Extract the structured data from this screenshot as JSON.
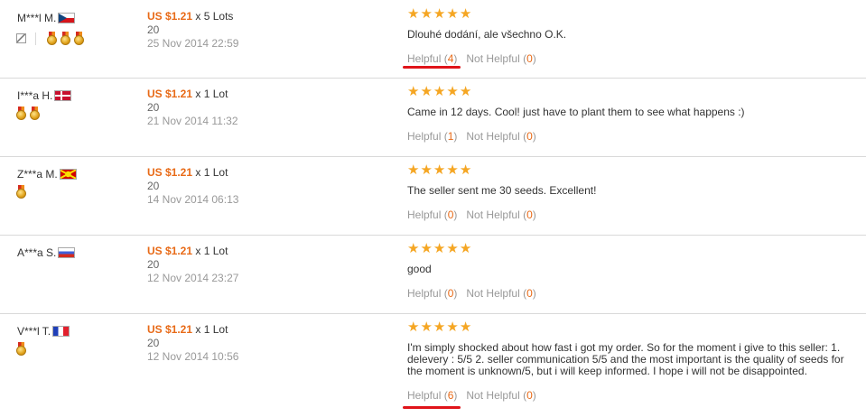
{
  "reviews": [
    {
      "buyer": "M***l M.",
      "flag": "cz",
      "medals": 3,
      "has_edit_icon": true,
      "price": "US $1.21",
      "quantity": "x 5 Lots",
      "pieces": "20",
      "date": "25 Nov 2014 22:59",
      "stars": 5,
      "text": "Dlouhé dodání, ale všechno O.K.",
      "helpful_label": "Helpful",
      "helpful_count": "4",
      "not_helpful_label": "Not Helpful",
      "not_helpful_count": "0",
      "underlined": true
    },
    {
      "buyer": "I***a H.",
      "flag": "dk",
      "medals": 2,
      "has_edit_icon": false,
      "price": "US $1.21",
      "quantity": "x 1 Lot",
      "pieces": "20",
      "date": "21 Nov 2014 11:32",
      "stars": 5,
      "text": "Came in 12 days. Cool! just have to plant them to see what happens :)",
      "helpful_label": "Helpful",
      "helpful_count": "1",
      "not_helpful_label": "Not Helpful",
      "not_helpful_count": "0",
      "underlined": false
    },
    {
      "buyer": "Z***a M.",
      "flag": "mk",
      "medals": 1,
      "has_edit_icon": false,
      "price": "US $1.21",
      "quantity": "x 1 Lot",
      "pieces": "20",
      "date": "14 Nov 2014 06:13",
      "stars": 5,
      "text": "The seller sent me 30 seeds. Excellent!",
      "helpful_label": "Helpful",
      "helpful_count": "0",
      "not_helpful_label": "Not Helpful",
      "not_helpful_count": "0",
      "underlined": false
    },
    {
      "buyer": "A***a S.",
      "flag": "ru",
      "medals": 0,
      "has_edit_icon": false,
      "price": "US $1.21",
      "quantity": "x 1 Lot",
      "pieces": "20",
      "date": "12 Nov 2014 23:27",
      "stars": 5,
      "text": "good",
      "helpful_label": "Helpful",
      "helpful_count": "0",
      "not_helpful_label": "Not Helpful",
      "not_helpful_count": "0",
      "underlined": false
    },
    {
      "buyer": "V***l T.",
      "flag": "fr",
      "medals": 1,
      "has_edit_icon": false,
      "price": "US $1.21",
      "quantity": "x 1 Lot",
      "pieces": "20",
      "date": "12 Nov 2014 10:56",
      "stars": 5,
      "text": "I'm simply shocked about how fast i got my order. So for the moment i give to this seller: 1. delevery : 5/5 2. seller communication 5/5 and the most important is the quality of seeds for the moment is unknown/5, but i will keep informed. I hope i will not be disappointed.",
      "helpful_label": "Helpful",
      "helpful_count": "6",
      "not_helpful_label": "Not Helpful",
      "not_helpful_count": "0",
      "underlined": true
    }
  ],
  "colors": {
    "price": "#e86a17",
    "star": "#f5a623",
    "underline": "#e0141a",
    "divider": "#d9d9d9"
  },
  "icons": {
    "star": "star-icon",
    "medal": "medal-icon",
    "edit": "edit-icon"
  }
}
